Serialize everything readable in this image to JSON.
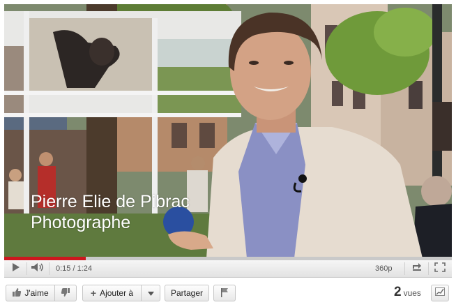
{
  "video": {
    "caption_line1": "Pierre Elie  de Pibrac",
    "caption_line2": "Photographe",
    "progress_fraction": 0.183
  },
  "controls": {
    "play_icon": "play-icon",
    "volume_icon": "volume-icon",
    "time": "0:15 / 1:24",
    "quality": "360p",
    "popout_icon": "popout-icon",
    "fullscreen_icon": "fullscreen-icon"
  },
  "actions": {
    "like_label": "J'aime",
    "like_icon": "thumbs-up-icon",
    "dislike_icon": "thumbs-down-icon",
    "add_label": "Ajouter à",
    "add_icon": "plus-icon",
    "dropdown_icon": "chevron-down-icon",
    "share_label": "Partager",
    "flag_icon": "flag-icon",
    "views_count": "2",
    "views_label": "vues",
    "stats_icon": "stats-chart-icon"
  },
  "colors": {
    "progress": "#cc181e",
    "jacket": "#e6dcd0",
    "shirt": "#8a90c4"
  }
}
